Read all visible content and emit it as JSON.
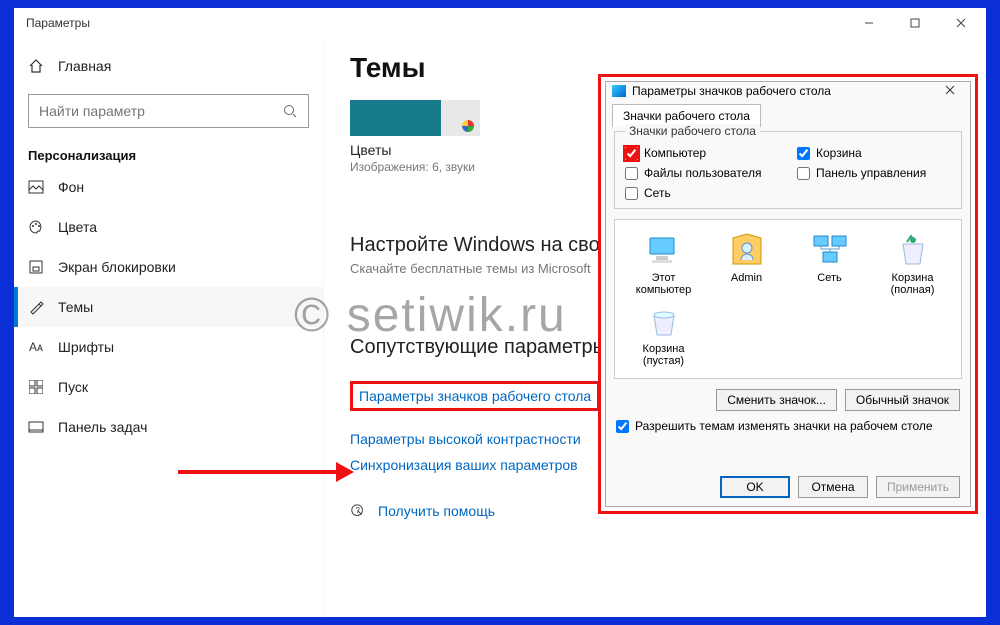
{
  "window": {
    "title": "Параметры"
  },
  "sidebar": {
    "home": "Главная",
    "search_placeholder": "Найти параметр",
    "section": "Персонализация",
    "items": [
      {
        "label": "Фон"
      },
      {
        "label": "Цвета"
      },
      {
        "label": "Экран блокировки"
      },
      {
        "label": "Темы"
      },
      {
        "label": "Шрифты"
      },
      {
        "label": "Пуск"
      },
      {
        "label": "Панель задач"
      }
    ]
  },
  "main": {
    "heading": "Темы",
    "theme_name": "Цветы",
    "theme_sub": "Изображения: 6, звуки",
    "cta_title": "Настройте Windows на свой",
    "cta_sub": "Скачайте бесплатные темы из Microsoft",
    "related_heading": "Сопутствующие параметры",
    "links": {
      "desktop_icons": "Параметры значков рабочего стола",
      "high_contrast": "Параметры высокой контрастности",
      "sync": "Синхронизация ваших параметров",
      "help": "Получить помощь"
    }
  },
  "dialog": {
    "title": "Параметры значков рабочего стола",
    "tab": "Значки рабочего стола",
    "group": "Значки рабочего стола",
    "checks": {
      "computer": "Компьютер",
      "recycle": "Корзина",
      "userfiles": "Файлы пользователя",
      "ctrlpanel": "Панель управления",
      "network": "Сеть"
    },
    "icons": {
      "pc": "Этот компьютер",
      "admin": "Admin",
      "net": "Сеть",
      "bin_full": "Корзина (полная)",
      "bin_empty": "Корзина (пустая)"
    },
    "change_icon": "Сменить значок...",
    "default_icon": "Обычный значок",
    "allow_themes": "Разрешить темам изменять значки на рабочем столе",
    "ok": "OK",
    "cancel": "Отмена",
    "apply": "Применить"
  },
  "watermark": "© setiwik.ru"
}
